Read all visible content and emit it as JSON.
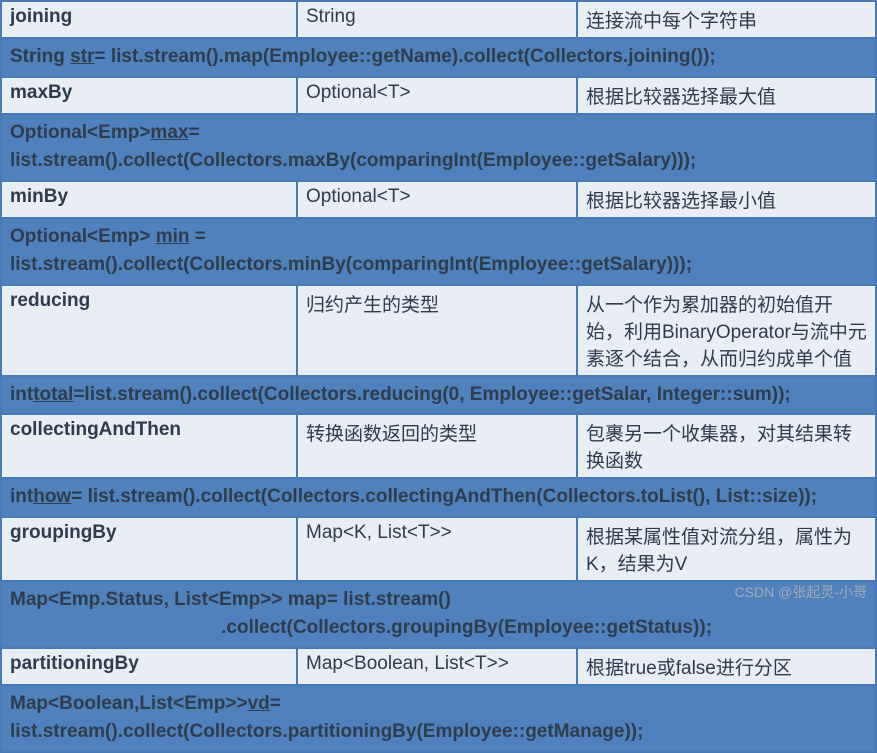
{
  "rows": [
    {
      "type": "data",
      "method": "joining",
      "ret": "String",
      "desc": "连接流中每个字符串"
    },
    {
      "type": "code",
      "pre": "String ",
      "uvar": "str",
      "post": "= list.stream().map(Employee::getName).collect(Collectors.joining());"
    },
    {
      "type": "data",
      "method": "maxBy",
      "ret": "Optional<T>",
      "desc": "根据比较器选择最大值"
    },
    {
      "type": "code",
      "pre": "Optional<Emp>",
      "uvar": "max",
      "post": "= list.stream().collect(Collectors.maxBy(comparingInt(Employee::getSalary)));"
    },
    {
      "type": "data",
      "method": "minBy",
      "ret": "Optional<T>",
      "desc": "根据比较器选择最小值"
    },
    {
      "type": "code",
      "pre": "Optional<Emp> ",
      "uvar": "min",
      "post": " = list.stream().collect(Collectors.minBy(comparingInt(Employee::getSalary)));"
    },
    {
      "type": "data",
      "method": "reducing",
      "ret": "归约产生的类型",
      "desc": "从一个作为累加器的初始值开始，利用BinaryOperator与流中元素逐个结合，从而归约成单个值"
    },
    {
      "type": "code",
      "pre": "int",
      "uvar": "total",
      "post": "=list.stream().collect(Collectors.reducing(0, Employee::getSalar, Integer::sum));"
    },
    {
      "type": "data",
      "method": "collectingAndThen",
      "ret": "转换函数返回的类型",
      "desc": "包裹另一个收集器，对其结果转换函数"
    },
    {
      "type": "code",
      "pre": "int",
      "uvar": "how",
      "post": "= list.stream().collect(Collectors.collectingAndThen(Collectors.toList(), List::size));"
    },
    {
      "type": "data",
      "method": "groupingBy",
      "ret": "Map<K, List<T>>",
      "desc": "根据某属性值对流分组，属性为K，结果为V"
    },
    {
      "type": "code",
      "pre": "Map<Emp.Status, List<Emp>> map= list.stream()\n                                        .collect(Collectors.groupingBy(Employee::getStatus));",
      "uvar": "",
      "post": ""
    },
    {
      "type": "data",
      "method": "partitioningBy",
      "ret": "Map<Boolean, List<T>>",
      "desc": "根据true或false进行分区"
    },
    {
      "type": "code",
      "pre": "Map<Boolean,List<Emp>>",
      "uvar": "vd",
      "post": "= list.stream().collect(Collectors.partitioningBy(Employee::getManage));"
    }
  ],
  "watermark": "CSDN @张起灵-小哥"
}
